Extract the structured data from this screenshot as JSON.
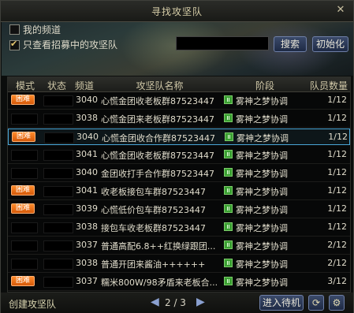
{
  "window": {
    "title": "寻找攻坚队",
    "close_symbol": "✕"
  },
  "filters": {
    "my_channel": {
      "label": "我的频道",
      "checked": false
    },
    "recruiting_only": {
      "label": "只查看招募中的攻坚队",
      "checked": true
    },
    "search_value": "",
    "search_button": "搜索",
    "reset_button": "初始化"
  },
  "table": {
    "headers": {
      "mode": "模式",
      "status": "状态",
      "channel": "频道",
      "name": "攻坚队名称",
      "stage": "阶段",
      "count": "队员数量"
    },
    "rows": [
      {
        "mode": "困难",
        "channel": "3040",
        "name": "心慌金团收老板群87523447",
        "stage": "雾神之梦协调",
        "count": "1/12"
      },
      {
        "mode": "",
        "channel": "3038",
        "name": "心慌金团来老板群87523447",
        "stage": "雾神之梦协调",
        "count": "1/12"
      },
      {
        "mode": "困难",
        "channel": "3040",
        "name": "心慌金团收合作群87523447",
        "stage": "雾神之梦协调",
        "count": "1/12",
        "selected": true
      },
      {
        "mode": "",
        "channel": "3041",
        "name": "心慌金团收老板群87523447",
        "stage": "雾神之梦协调",
        "count": "1/12"
      },
      {
        "mode": "",
        "channel": "3040",
        "name": "金团收打手合作群87523447",
        "stage": "雾神之梦协调",
        "count": "1/12"
      },
      {
        "mode": "困难",
        "channel": "3041",
        "name": "收老板接包车群87523447",
        "stage": "雾神之梦协调",
        "count": "1/12"
      },
      {
        "mode": "困难",
        "channel": "3039",
        "name": "心慌低价包车群87523447",
        "stage": "雾神之梦协调",
        "count": "1/12"
      },
      {
        "mode": "",
        "channel": "3038",
        "name": "接包车收老板群87523447",
        "stage": "雾神之梦协调",
        "count": "1/12"
      },
      {
        "mode": "",
        "channel": "3037",
        "name": "普通高配6.8++红换绿跟团...",
        "stage": "雾神之梦协调",
        "count": "2/12"
      },
      {
        "mode": "",
        "channel": "3038",
        "name": "普通开团来酱油++++++",
        "stage": "雾神之梦协调",
        "count": "2/12"
      },
      {
        "mode": "困难",
        "channel": "3037",
        "name": "糯米800W/98矛盾来老板合...",
        "stage": "雾神之梦协调",
        "count": "3/12"
      }
    ]
  },
  "footer": {
    "create_link": "创建攻坚队",
    "page_text": "2 / 3",
    "enter_queue_button": "进入待机",
    "refresh_icon": "refresh-icon",
    "settings_icon": "gear-icon"
  },
  "colors": {
    "hard_tag": "#ff8a2a",
    "selection": "#4aa6d6",
    "stage_icon": "#3aa032"
  }
}
